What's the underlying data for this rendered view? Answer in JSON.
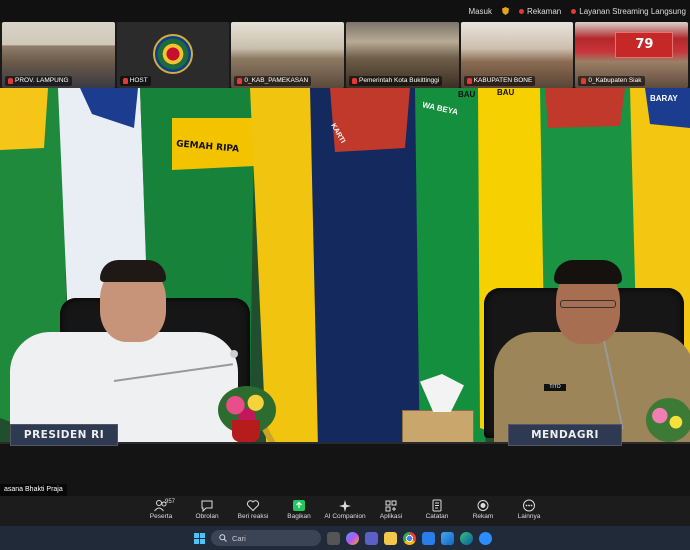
{
  "topbar": {
    "masuk": "Masuk",
    "rekaman": "Rekaman",
    "live": "Layanan Streaming Langsung"
  },
  "thumbnails": [
    {
      "label": "PROV. LAMPUNG"
    },
    {
      "label": "HOST"
    },
    {
      "label": "0_KAB_PAMEKASAN"
    },
    {
      "label": "Pemerintah Kota Bukittinggi"
    },
    {
      "label": "KABUPATEN BONE"
    },
    {
      "label": "0_Kabupaten Siak"
    }
  ],
  "video": {
    "speaker_label": "asana Bhakti Praja",
    "nameplate_left": "PRESIDEN RI",
    "nameplate_right": "MENDAGRI",
    "flag_texts": [
      "GEMAH RIPA",
      "BAU",
      "WA BEYA",
      "BAU",
      "BARAY",
      "KARTI"
    ],
    "nametag": "TITO",
    "banner_number": "79"
  },
  "toolbar": {
    "participants_count": "957",
    "items": [
      {
        "label": "Peserta",
        "icon": "participants-icon"
      },
      {
        "label": "Obrolan",
        "icon": "chat-icon"
      },
      {
        "label": "Beri reaksi",
        "icon": "heart-icon"
      },
      {
        "label": "Bagikan",
        "icon": "share-icon"
      },
      {
        "label": "AI Companion",
        "icon": "sparkle-icon"
      },
      {
        "label": "Aplikasi",
        "icon": "apps-icon"
      },
      {
        "label": "Catatan",
        "icon": "notes-icon"
      },
      {
        "label": "Rekam",
        "icon": "record-icon"
      },
      {
        "label": "Lainnya",
        "icon": "more-icon"
      }
    ]
  },
  "taskbar": {
    "search_text": "Cari"
  },
  "colors": {
    "accent_green": "#22c55e",
    "record_red": "#e53935",
    "toolbar_bg": "#1c1c1c",
    "taskbar_bg": "#202a38"
  }
}
